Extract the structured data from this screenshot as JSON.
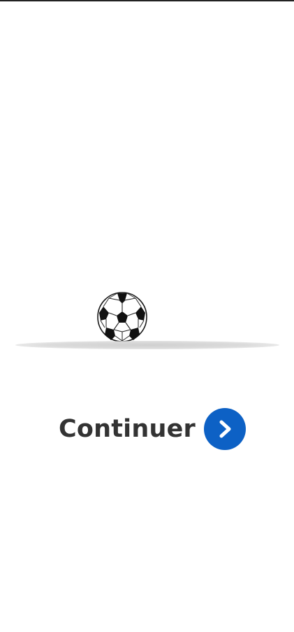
{
  "scene": {
    "ball_icon": "soccer-ball-icon",
    "shadow": "ground-shadow"
  },
  "continue": {
    "label": "Continuer",
    "icon": "chevron-right-icon",
    "accent_color": "#0d61c5",
    "text_color": "#333333"
  }
}
